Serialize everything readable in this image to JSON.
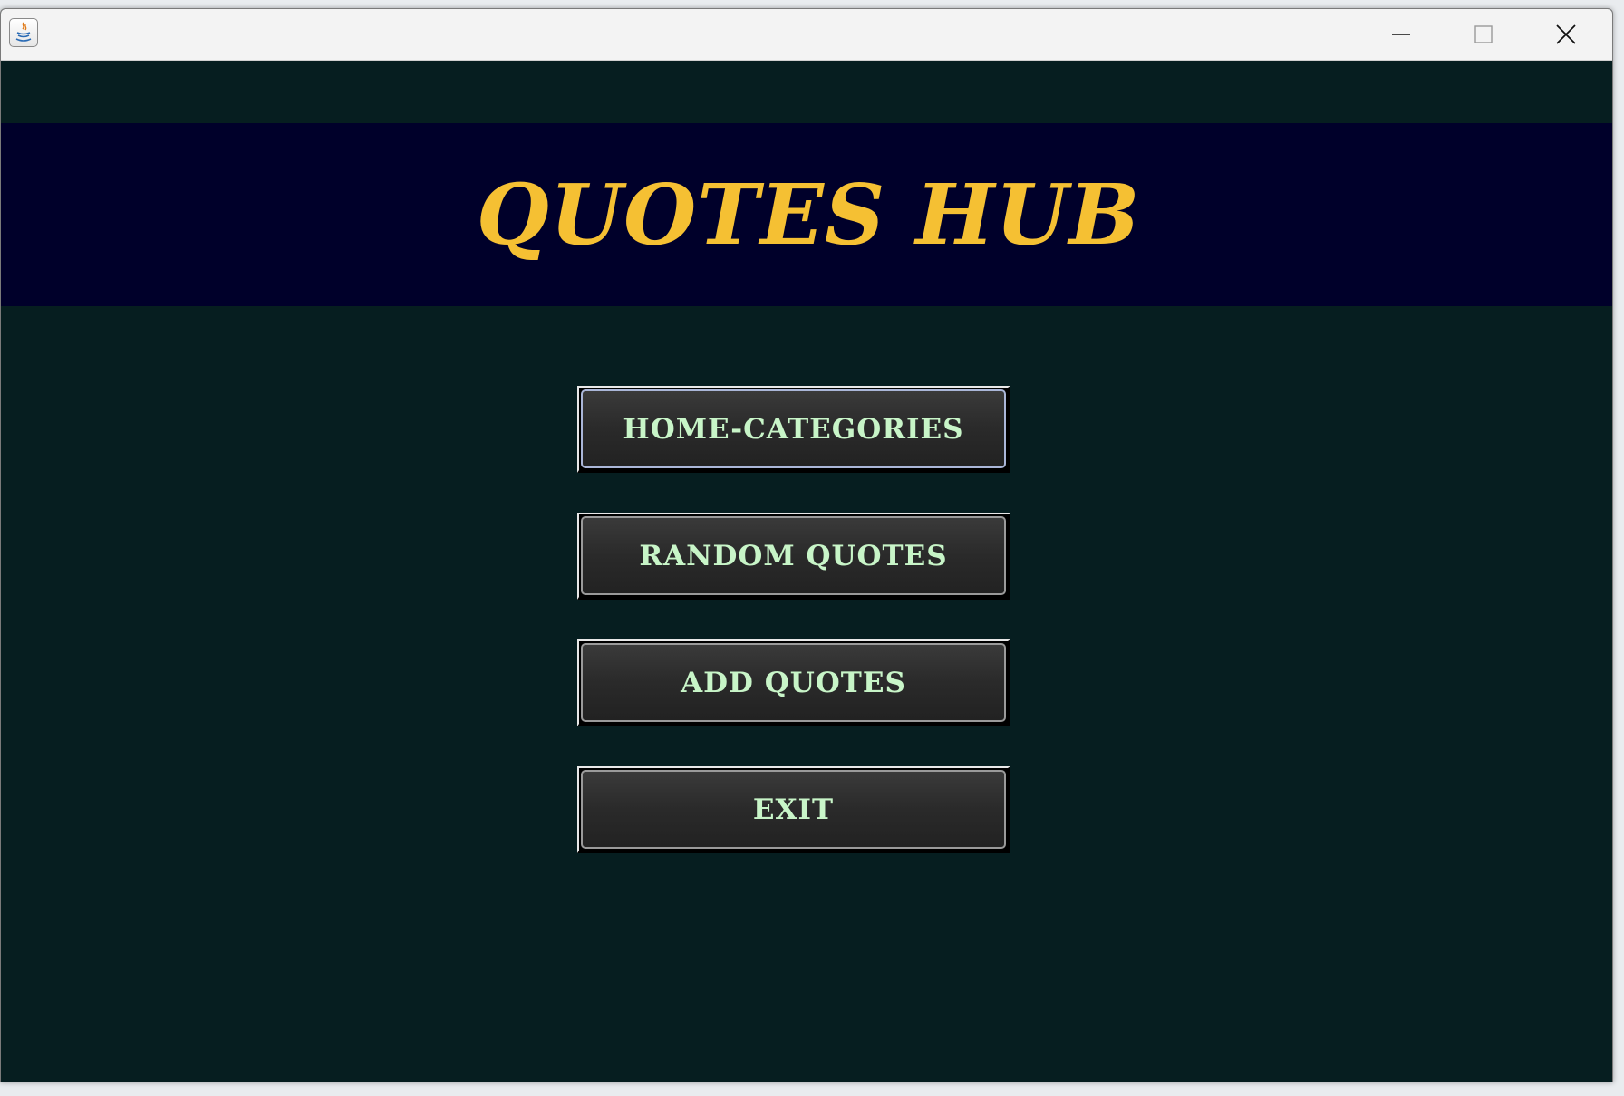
{
  "window": {
    "controls": {
      "minimize_icon": "minimize-icon",
      "maximize_icon": "maximize-icon",
      "close_icon": "close-icon"
    },
    "app_icon": "java-icon"
  },
  "header": {
    "title": "QUOTES HUB"
  },
  "menu": {
    "home_categories": "HOME-CATEGORIES",
    "random_quotes": "RANDOM QUOTES",
    "add_quotes": "ADD QUOTES",
    "exit": "EXIT"
  },
  "colors": {
    "background": "#061e20",
    "header_band": "#00002a",
    "title": "#f5c033",
    "button_text": "#c8f5c8",
    "button_face": "#2a2a2a"
  }
}
